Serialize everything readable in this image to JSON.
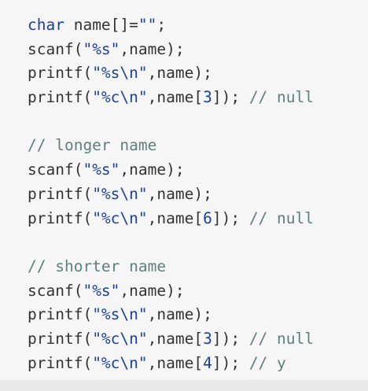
{
  "code_lines": [
    [
      {
        "t": "char",
        "c": "kw"
      },
      {
        "t": " name[]=",
        "c": "tx"
      },
      {
        "t": "\"\"",
        "c": "str"
      },
      {
        "t": ";",
        "c": "tx"
      }
    ],
    [
      {
        "t": "scanf(",
        "c": "tx"
      },
      {
        "t": "\"%s\"",
        "c": "str"
      },
      {
        "t": ",name);",
        "c": "tx"
      }
    ],
    [
      {
        "t": "printf(",
        "c": "tx"
      },
      {
        "t": "\"%s\\n\"",
        "c": "str"
      },
      {
        "t": ",name);",
        "c": "tx"
      }
    ],
    [
      {
        "t": "printf(",
        "c": "tx"
      },
      {
        "t": "\"%c\\n\"",
        "c": "str"
      },
      {
        "t": ",name[",
        "c": "tx"
      },
      {
        "t": "3",
        "c": "num"
      },
      {
        "t": "]); ",
        "c": "tx"
      },
      {
        "t": "// null",
        "c": "cm"
      }
    ],
    [],
    [
      {
        "t": "// longer name",
        "c": "cm"
      }
    ],
    [
      {
        "t": "scanf(",
        "c": "tx"
      },
      {
        "t": "\"%s\"",
        "c": "str"
      },
      {
        "t": ",name);",
        "c": "tx"
      }
    ],
    [
      {
        "t": "printf(",
        "c": "tx"
      },
      {
        "t": "\"%s\\n\"",
        "c": "str"
      },
      {
        "t": ",name);",
        "c": "tx"
      }
    ],
    [
      {
        "t": "printf(",
        "c": "tx"
      },
      {
        "t": "\"%c\\n\"",
        "c": "str"
      },
      {
        "t": ",name[",
        "c": "tx"
      },
      {
        "t": "6",
        "c": "num"
      },
      {
        "t": "]); ",
        "c": "tx"
      },
      {
        "t": "// null",
        "c": "cm"
      }
    ],
    [],
    [
      {
        "t": "// shorter name",
        "c": "cm"
      }
    ],
    [
      {
        "t": "scanf(",
        "c": "tx"
      },
      {
        "t": "\"%s\"",
        "c": "str"
      },
      {
        "t": ",name);",
        "c": "tx"
      }
    ],
    [
      {
        "t": "printf(",
        "c": "tx"
      },
      {
        "t": "\"%s\\n\"",
        "c": "str"
      },
      {
        "t": ",name);",
        "c": "tx"
      }
    ],
    [
      {
        "t": "printf(",
        "c": "tx"
      },
      {
        "t": "\"%c\\n\"",
        "c": "str"
      },
      {
        "t": ",name[",
        "c": "tx"
      },
      {
        "t": "3",
        "c": "num"
      },
      {
        "t": "]); ",
        "c": "tx"
      },
      {
        "t": "// null",
        "c": "cm"
      }
    ],
    [
      {
        "t": "printf(",
        "c": "tx"
      },
      {
        "t": "\"%c\\n\"",
        "c": "str"
      },
      {
        "t": ",name[",
        "c": "tx"
      },
      {
        "t": "4",
        "c": "num"
      },
      {
        "t": "]); ",
        "c": "tx"
      },
      {
        "t": "// y",
        "c": "cm"
      }
    ]
  ],
  "colors": {
    "keyword": "#1b3fa0",
    "string": "#1b3fa0",
    "comment": "#5e7f7c",
    "text": "#333333",
    "background": "#f6f6f6"
  }
}
